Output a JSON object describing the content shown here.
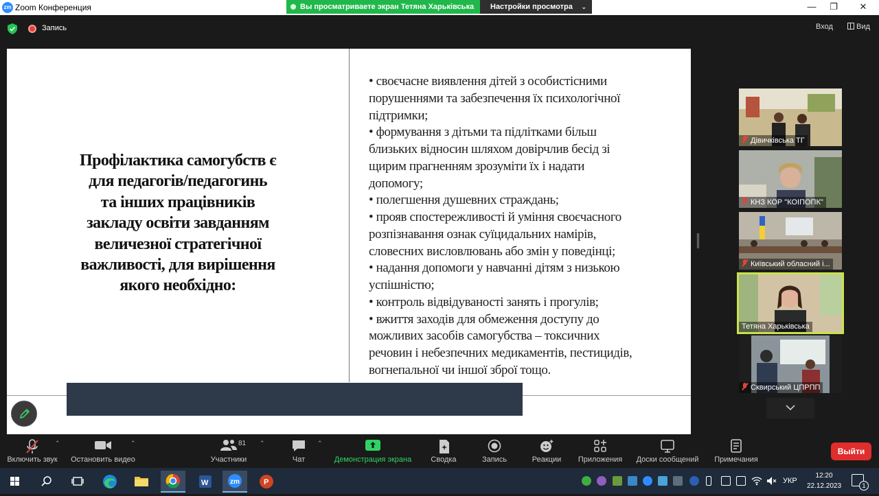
{
  "window": {
    "app_icon": "zm",
    "title": "Zoom Конференция",
    "minimize": "—",
    "maximize": "❐",
    "close": "✕"
  },
  "share_banner": {
    "text": "Вы просматриваете экран Тетяна Харьківська",
    "view_options": "Настройки просмотра"
  },
  "topbar": {
    "recording": "Запись",
    "enter": "Вход",
    "view": "Вид"
  },
  "slide": {
    "title_lines": [
      "Профілактика самогубств є",
      "для педагогів/педагогинь",
      "та інших працівників",
      "закладу освіти завданням",
      "величезної стратегічної",
      "важливості, для вирішення",
      "якого необхідно:"
    ],
    "bullet_lines": [
      "• своєчасне виявлення дітей з особистісними",
      "порушеннями та забезпечення їх психологічної",
      "підтримки;",
      "• формування з дітьми та підлітками більш",
      "близьких відносин шляхом довірчлив бесід зі",
      "щирим прагненням зрозуміти їх і надати",
      "допомогу;",
      "• полегшення душевних страждань;",
      "• прояв спостережливості й уміння своєчасного",
      "розпізнавання ознак суїцидальних намірів,",
      "словесних висловлювань або змін у поведінці;",
      "• надання допомоги у навчанні дітям з низькою",
      "успішністю;",
      "• контроль відвідуваності занять і прогулів;",
      "• вжиття заходів для обмеження доступу до",
      "можливих засобів самогубства – токсичних",
      "речовин і небезпечних медикаментів, пестицидів,",
      "вогнепальної чи іншої зброї тощо."
    ]
  },
  "participants": [
    {
      "name": "Дівичківська ТГ",
      "muted": true,
      "bg": "#b8a77e",
      "active": false
    },
    {
      "name": "КНЗ КОР \"КОІПОПК\"",
      "muted": true,
      "bg": "#9fa39b",
      "active": false
    },
    {
      "name": "Київський обласний і...",
      "muted": true,
      "bg": "#7c7468",
      "active": false
    },
    {
      "name": "Тетяна Харьківська",
      "muted": false,
      "bg": "#c7b69a",
      "active": true
    },
    {
      "name": "Сквирський ЦПРПП",
      "muted": true,
      "bg": "#6f7e88",
      "active": false
    }
  ],
  "toolbar": {
    "unmute": "Включить звук",
    "stop_video": "Остановить видео",
    "participants": "Участники",
    "participants_count": "81",
    "chat": "Чат",
    "share_screen": "Демонстрация экрана",
    "summary": "Сводка",
    "record": "Запись",
    "reactions": "Реакции",
    "apps": "Приложения",
    "whiteboards": "Доски сообщений",
    "notes": "Примечания",
    "leave": "Выйти"
  },
  "taskbar": {
    "language": "УКР",
    "time": "12:20",
    "date": "22.12.2023",
    "notifications": "1"
  },
  "colors": {
    "zoom_blue": "#2d8cff",
    "share_green": "#21b84b",
    "leave_red": "#e02d2d",
    "active_speaker": "#c9e24b",
    "slide_bar": "#2e3a49"
  }
}
